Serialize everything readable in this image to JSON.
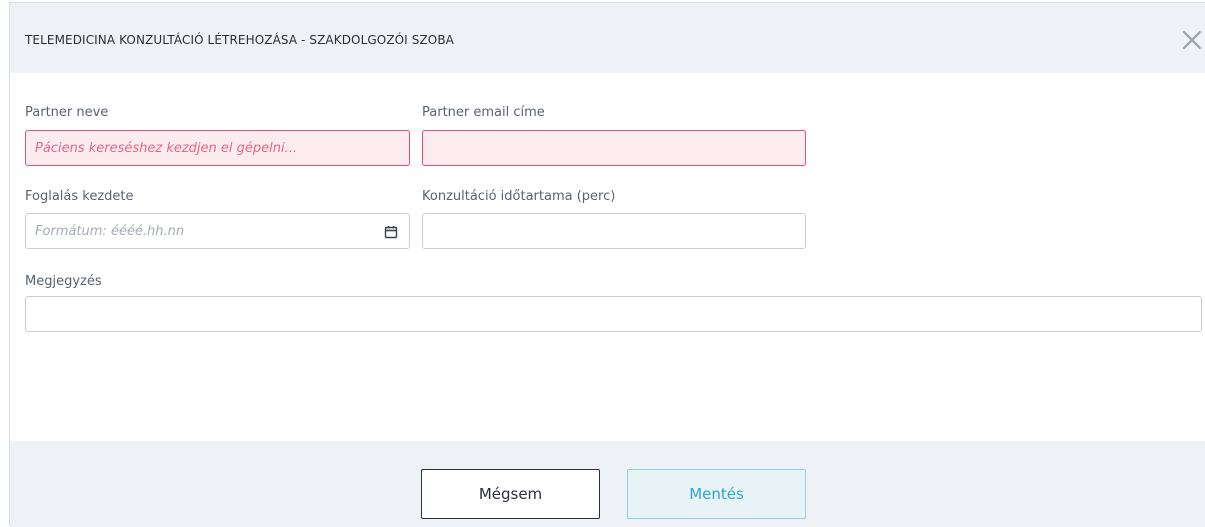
{
  "dialog": {
    "title": "TELEMEDICINA KONZULTÁCIÓ LÉTREHOZÁSA  - SZAKDOLGOZÓI SZOBA",
    "close_icon": "close-icon"
  },
  "form": {
    "partner_name": {
      "label": "Partner neve",
      "value": "",
      "placeholder": "Páciens kereséshez kezdjen el gépelni...",
      "state": "error"
    },
    "partner_email": {
      "label": "Partner email címe",
      "value": "",
      "placeholder": "",
      "state": "error"
    },
    "booking_start": {
      "label": "Foglalás kezdete",
      "value": "",
      "placeholder": "Formátum: éééé.hh.nn",
      "icon": "calendar-icon"
    },
    "duration": {
      "label": "Konzultáció időtartama (perc)",
      "value": "",
      "placeholder": ""
    },
    "note": {
      "label": "Megjegyzés",
      "value": "",
      "placeholder": ""
    }
  },
  "footer": {
    "cancel_label": "Mégsem",
    "save_label": "Mentés"
  },
  "colors": {
    "header_bg": "#eef1f6",
    "error_border": "#e0507a",
    "error_bg": "#fdecef",
    "accent": "#2aa8cf"
  }
}
